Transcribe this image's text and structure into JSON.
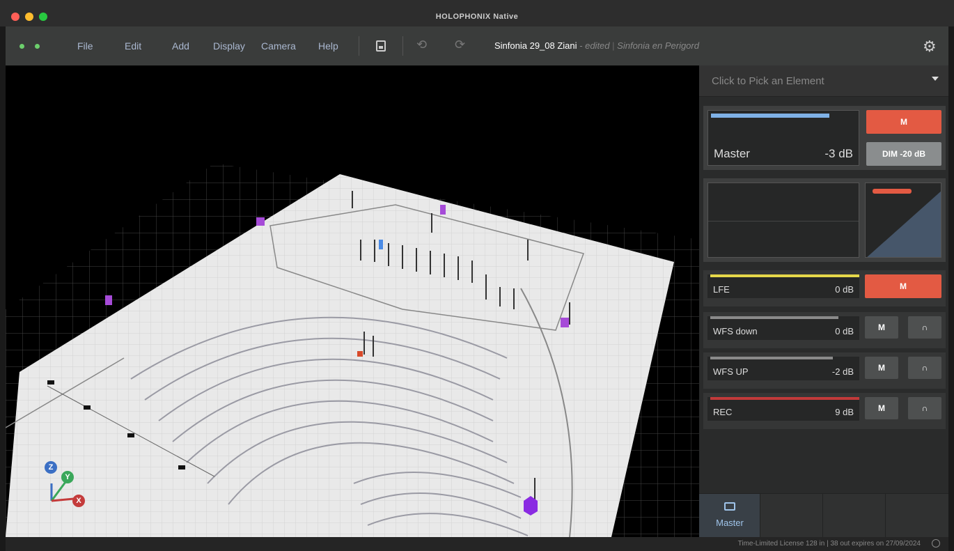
{
  "window": {
    "title": "HOLOPHONIX Native"
  },
  "menu": {
    "items": [
      "File",
      "Edit",
      "Add",
      "Display",
      "Camera",
      "Help"
    ]
  },
  "document": {
    "name": "Sinfonia 29_08 Ziani",
    "edited": "- edited",
    "venue": "Sinfonia en Perigord"
  },
  "picker": {
    "placeholder": "Click to Pick an Element"
  },
  "master": {
    "name": "Master",
    "level": "-3 dB",
    "mute_label": "M",
    "dim_label": "DIM -20 dB"
  },
  "buses": [
    {
      "name": "LFE",
      "level": "0 dB",
      "mute_label": "M",
      "color": "#e6d84a",
      "muted": true
    },
    {
      "name": "WFS down",
      "level": "0 dB",
      "mute_label": "M",
      "color": "#8a8a8a",
      "muted": false
    },
    {
      "name": "WFS UP",
      "level": "-2 dB",
      "mute_label": "M",
      "color": "#8a8a8a",
      "muted": false
    },
    {
      "name": "REC",
      "level": "9 dB",
      "mute_label": "M",
      "color": "#c23a3a",
      "muted": false
    }
  ],
  "tabs": {
    "active_label": "Master"
  },
  "status": {
    "license": "Time-Limited License 128 in | 38 out expires on 27/09/2024"
  },
  "gizmo": {
    "z": "Z",
    "y": "Y",
    "x": "X"
  },
  "colors": {
    "accent_red": "#e35a43",
    "master_meter": "#7fb1e6",
    "lfe_meter": "#e6d84a",
    "rec_meter": "#c23a3a"
  }
}
